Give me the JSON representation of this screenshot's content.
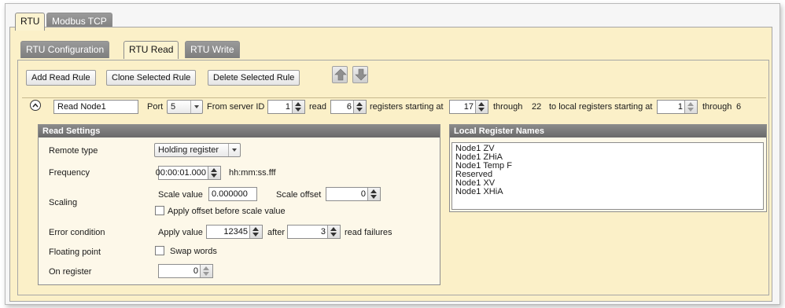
{
  "top_tabs": [
    {
      "label": "RTU",
      "active": true
    },
    {
      "label": "Modbus TCP",
      "active": false
    }
  ],
  "sub_tabs": [
    {
      "label": "RTU Configuration",
      "active": false
    },
    {
      "label": "RTU Read",
      "active": true
    },
    {
      "label": "RTU Write",
      "active": false
    }
  ],
  "toolbar": {
    "add_label": "Add Read Rule",
    "clone_label": "Clone Selected Rule",
    "delete_label": "Delete Selected Rule",
    "move_up_icon": "arrow-up-icon",
    "move_down_icon": "arrow-down-icon"
  },
  "rule": {
    "name": "Read Node1",
    "port_label": "Port",
    "port_value": "5",
    "from_server_label": "From server ID",
    "server_id": "1",
    "read_label": "read",
    "register_count": "6",
    "registers_starting_label": "registers starting at",
    "start_register": "17",
    "through_label": "through",
    "through_value": "22",
    "local_label": "to local registers starting at",
    "local_start": "1",
    "local_through_label": "through",
    "local_through_value": "6"
  },
  "read_settings": {
    "title": "Read Settings",
    "remote_type_label": "Remote type",
    "remote_type_value": "Holding register",
    "frequency_label": "Frequency",
    "frequency_value": "00:00:01.000",
    "frequency_format": "hh:mm:ss.fff",
    "scaling_label": "Scaling",
    "scale_value_label": "Scale value",
    "scale_value": "0.000000",
    "scale_offset_label": "Scale offset",
    "scale_offset": "0",
    "apply_offset_label": "Apply offset before scale value",
    "apply_offset_checked": false,
    "error_label": "Error condition",
    "apply_value_label": "Apply value",
    "apply_value": "12345",
    "after_label": "after",
    "failures_value": "3",
    "failures_label": "read failures",
    "floating_label": "Floating point",
    "swap_words_label": "Swap words",
    "swap_words_checked": false,
    "on_register_label": "On register",
    "on_register_value": "0"
  },
  "local_register_names": {
    "title": "Local Register Names",
    "items": [
      "Node1 ZV",
      "Node1 ZHiA",
      "Node1 Temp F",
      "Reserved",
      "Node1 XV",
      "Node1 XHiA"
    ]
  },
  "colors": {
    "panel_bg": "#fbf0c8",
    "tab_inactive": "#8a8a8a",
    "group_header": "#777777"
  }
}
